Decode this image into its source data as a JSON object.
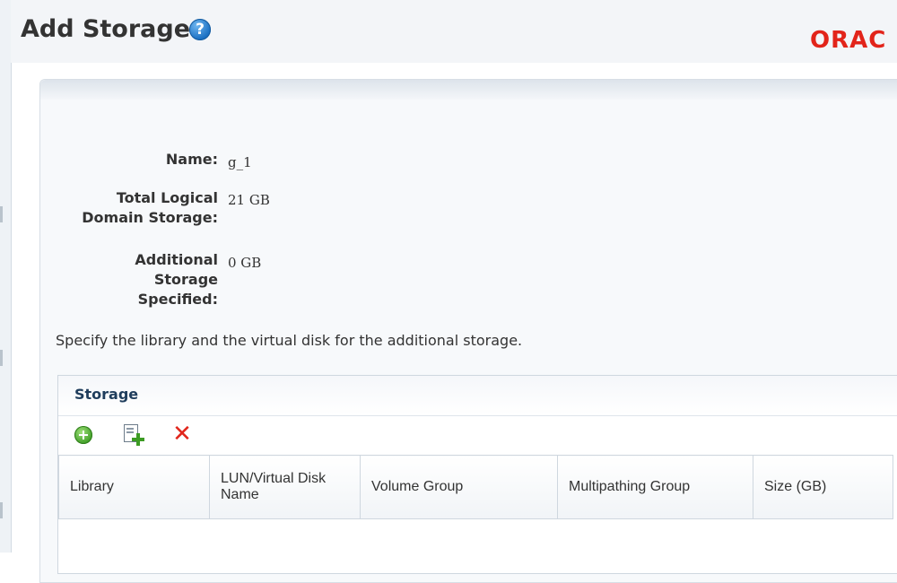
{
  "page": {
    "title": "Add Storage",
    "logo": "ORAC"
  },
  "fields": [
    {
      "label": "Name:",
      "value": "g_1"
    },
    {
      "label": "Total Logical\nDomain Storage:",
      "value": "21 GB"
    },
    {
      "label": "Additional\nStorage\nSpecified:",
      "value": "0 GB"
    }
  ],
  "instruction": "Specify the library and the virtual disk for the additional storage.",
  "storage": {
    "title": "Storage",
    "toolbar": {
      "add": "add-icon",
      "import": "import-disk-icon",
      "delete": "delete-icon"
    },
    "columns": [
      "Library",
      "LUN/Virtual Disk\nName",
      "Volume Group",
      "Multipathing Group",
      "Size (GB)"
    ]
  },
  "colors": {
    "brand": "#e2241a",
    "help": "#1a6fc2",
    "delete": "#e1261c",
    "add": "#3a9a22"
  }
}
